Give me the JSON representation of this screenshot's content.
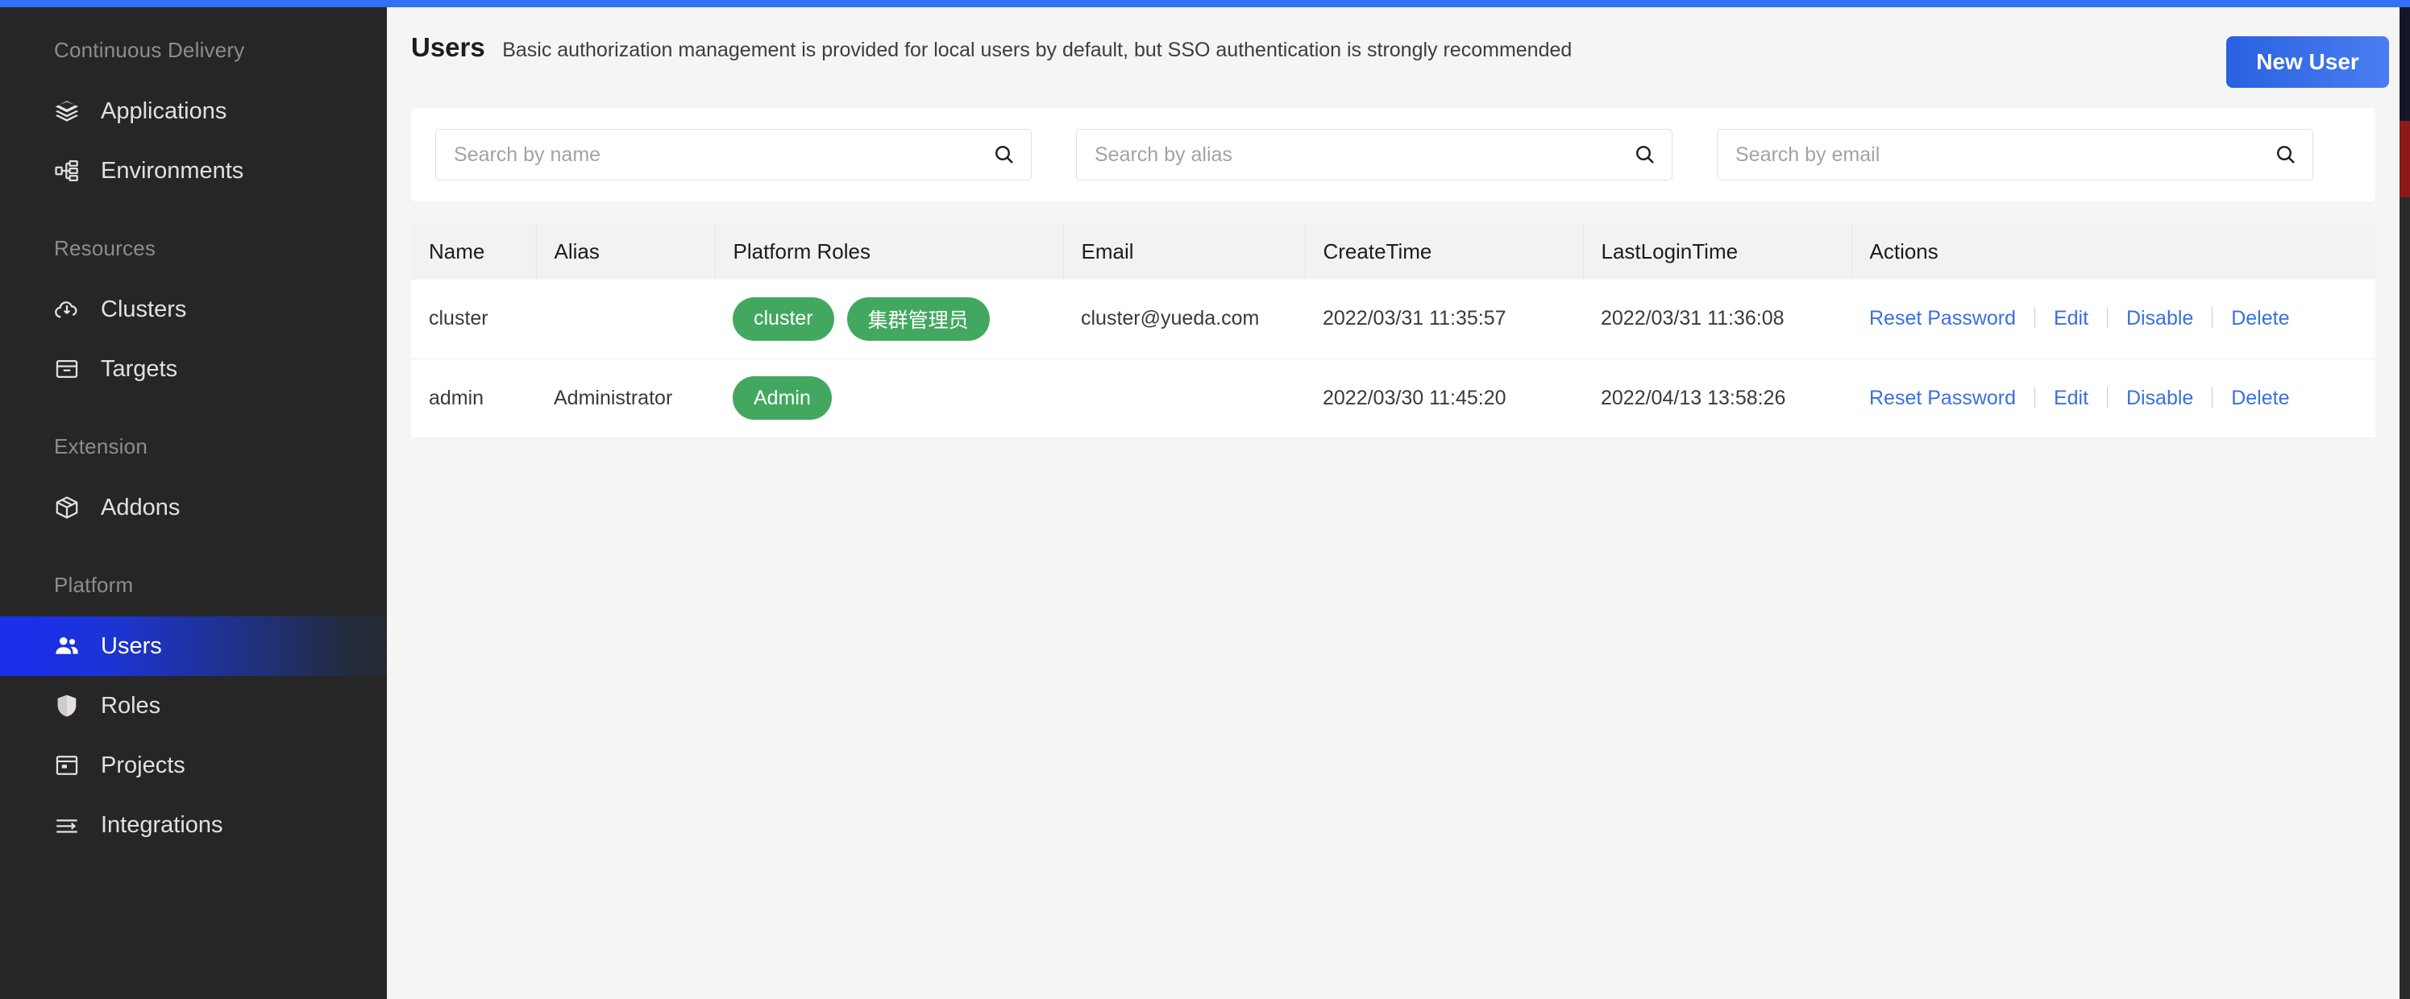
{
  "top_accent_color": "#3271f5",
  "sidebar": {
    "groups": [
      {
        "label": "Continuous Delivery",
        "items": [
          {
            "label": "Applications",
            "icon": "layers-icon",
            "active": false
          },
          {
            "label": "Environments",
            "icon": "environments-icon",
            "active": false
          }
        ]
      },
      {
        "label": "Resources",
        "items": [
          {
            "label": "Clusters",
            "icon": "cloud-download-icon",
            "active": false
          },
          {
            "label": "Targets",
            "icon": "archive-box-icon",
            "active": false
          }
        ]
      },
      {
        "label": "Extension",
        "items": [
          {
            "label": "Addons",
            "icon": "package-cube-icon",
            "active": false
          }
        ]
      },
      {
        "label": "Platform",
        "items": [
          {
            "label": "Users",
            "icon": "users-people-icon",
            "active": true
          },
          {
            "label": "Roles",
            "icon": "shield-icon",
            "active": false
          },
          {
            "label": "Projects",
            "icon": "projects-window-icon",
            "active": false
          },
          {
            "label": "Integrations",
            "icon": "integrations-arrow-icon",
            "active": false
          }
        ]
      }
    ],
    "active_item_gradient_from": "#1b2ee8",
    "active_item_gradient_to": "#262b33"
  },
  "header": {
    "title": "Users",
    "description": "Basic authorization management is provided for local users by default, but SSO authentication is strongly recommended",
    "new_user_label": "New User",
    "new_user_color": "#3b6fe0"
  },
  "search": {
    "fields": [
      {
        "name": "search-by-name",
        "placeholder": "Search by name",
        "value": ""
      },
      {
        "name": "search-by-alias",
        "placeholder": "Search by alias",
        "value": ""
      },
      {
        "name": "search-by-email",
        "placeholder": "Search by email",
        "value": ""
      }
    ]
  },
  "table": {
    "columns": [
      "Name",
      "Alias",
      "Platform Roles",
      "Email",
      "CreateTime",
      "LastLoginTime",
      "Actions"
    ],
    "badge_color": "#42a860",
    "action_color": "#3b6fe0",
    "rows": [
      {
        "name": "cluster",
        "alias": "",
        "roles": [
          "cluster",
          "集群管理员"
        ],
        "email": "cluster@yueda.com",
        "create_time": "2022/03/31 11:35:57",
        "last_login_time": "2022/03/31 11:36:08",
        "actions": [
          "Reset Password",
          "Edit",
          "Disable",
          "Delete"
        ]
      },
      {
        "name": "admin",
        "alias": "Administrator",
        "roles": [
          "Admin"
        ],
        "email": "",
        "create_time": "2022/03/30 11:45:20",
        "last_login_time": "2022/04/13 13:58:26",
        "actions": [
          "Reset Password",
          "Edit",
          "Disable",
          "Delete"
        ]
      }
    ]
  }
}
